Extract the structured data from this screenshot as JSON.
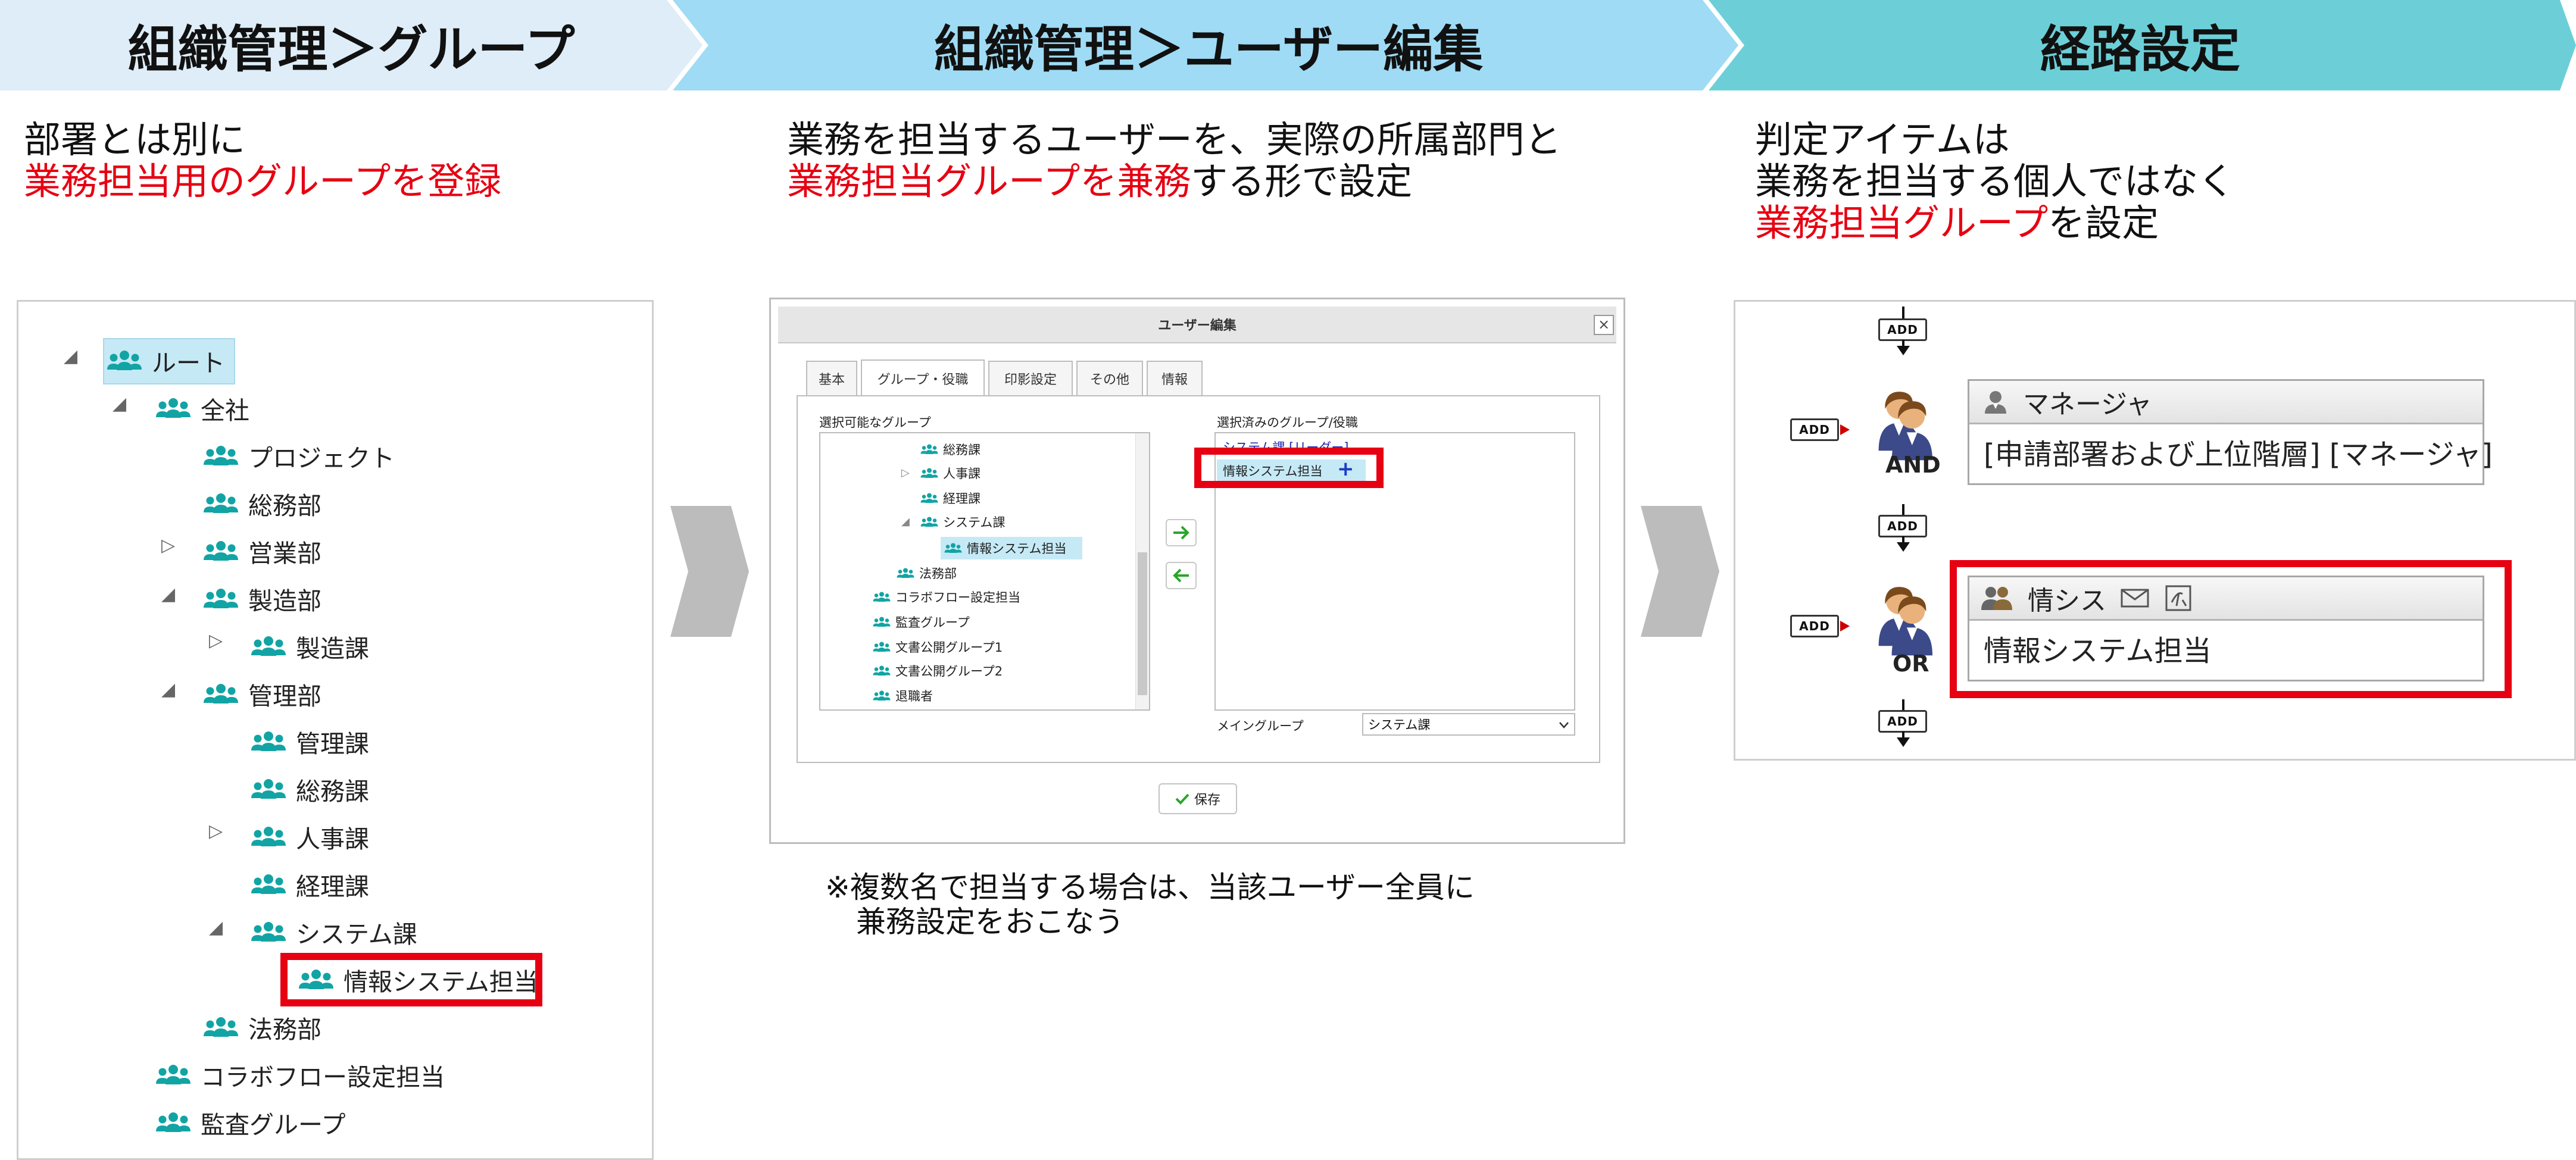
{
  "banner": {
    "step1": "組織管理＞グループ",
    "step2": "組織管理＞ユーザー編集",
    "step3": "経路設定",
    "colors": [
      "#deedf7",
      "#9fdbf4",
      "#6ccfd8"
    ]
  },
  "captions": {
    "c1_line1": "部署とは別に",
    "c1_line2_red": "業務担当用のグループを登録",
    "c2_line1": "業務を担当するユーザーを、実際の所属部門と",
    "c2_line2_red": "業務担当グループを兼務",
    "c2_line2_rest": "する形で設定",
    "c3_line1": "判定アイテムは",
    "c3_line2": "業務を担当する個人ではなく",
    "c3_line3_red": "業務担当グループ",
    "c3_line3_rest": "を設定",
    "accent_color": "#e60012"
  },
  "tree": {
    "nodes": [
      {
        "label": "ルート",
        "toggle": "◢"
      },
      {
        "label": "全社",
        "toggle": "◢"
      },
      {
        "label": "プロジェクト",
        "toggle": ""
      },
      {
        "label": "総務部",
        "toggle": ""
      },
      {
        "label": "営業部",
        "toggle": "▷"
      },
      {
        "label": "製造部",
        "toggle": "◢"
      },
      {
        "label": "製造課",
        "toggle": "▷"
      },
      {
        "label": "管理部",
        "toggle": "◢"
      },
      {
        "label": "管理課",
        "toggle": ""
      },
      {
        "label": "総務課",
        "toggle": ""
      },
      {
        "label": "人事課",
        "toggle": "▷"
      },
      {
        "label": "経理課",
        "toggle": ""
      },
      {
        "label": "システム課",
        "toggle": "◢"
      },
      {
        "label": "情報システム担当",
        "toggle": ""
      },
      {
        "label": "法務部",
        "toggle": ""
      },
      {
        "label": "コラボフロー設定担当",
        "toggle": ""
      },
      {
        "label": "監査グループ",
        "toggle": ""
      }
    ]
  },
  "dialog": {
    "title": "ユーザー編集",
    "close": "×",
    "tabs": [
      "基本",
      "グループ・役職",
      "印影設定",
      "その他",
      "情報"
    ],
    "available_label": "選択可能なグループ",
    "selected_label": "選択済みのグループ/役職",
    "available_groups": [
      {
        "label": "総務課",
        "toggle": ""
      },
      {
        "label": "人事課",
        "toggle": "▷"
      },
      {
        "label": "経理課",
        "toggle": ""
      },
      {
        "label": "システム課",
        "toggle": "◢"
      },
      {
        "label": "情報システム担当",
        "toggle": ""
      },
      {
        "label": "法務部",
        "toggle": ""
      },
      {
        "label": "コラボフロー設定担当",
        "toggle": ""
      },
      {
        "label": "監査グループ",
        "toggle": ""
      },
      {
        "label": "文書公開グループ1",
        "toggle": ""
      },
      {
        "label": "文書公開グループ2",
        "toggle": ""
      },
      {
        "label": "退職者",
        "toggle": ""
      }
    ],
    "selected_items": [
      "システム課 [リーダー]",
      "情報システム担当"
    ],
    "plus": "+",
    "main_group_label": "メイングループ",
    "main_group_value": "システム課",
    "save_label": "保存",
    "note_line1": "※複数名で担当する場合は、当該ユーザー全員に",
    "note_line2": "兼務設定をおこなう"
  },
  "flow": {
    "add_label": "ADD",
    "and_label": "AND",
    "or_label": "OR",
    "card1_title": "マネージャ",
    "card1_body": "[申請部署および上位階層] [マネージャ]",
    "card2_title": "情シス",
    "card2_body": "情報システム担当"
  },
  "icon_color": "#00a3a3"
}
